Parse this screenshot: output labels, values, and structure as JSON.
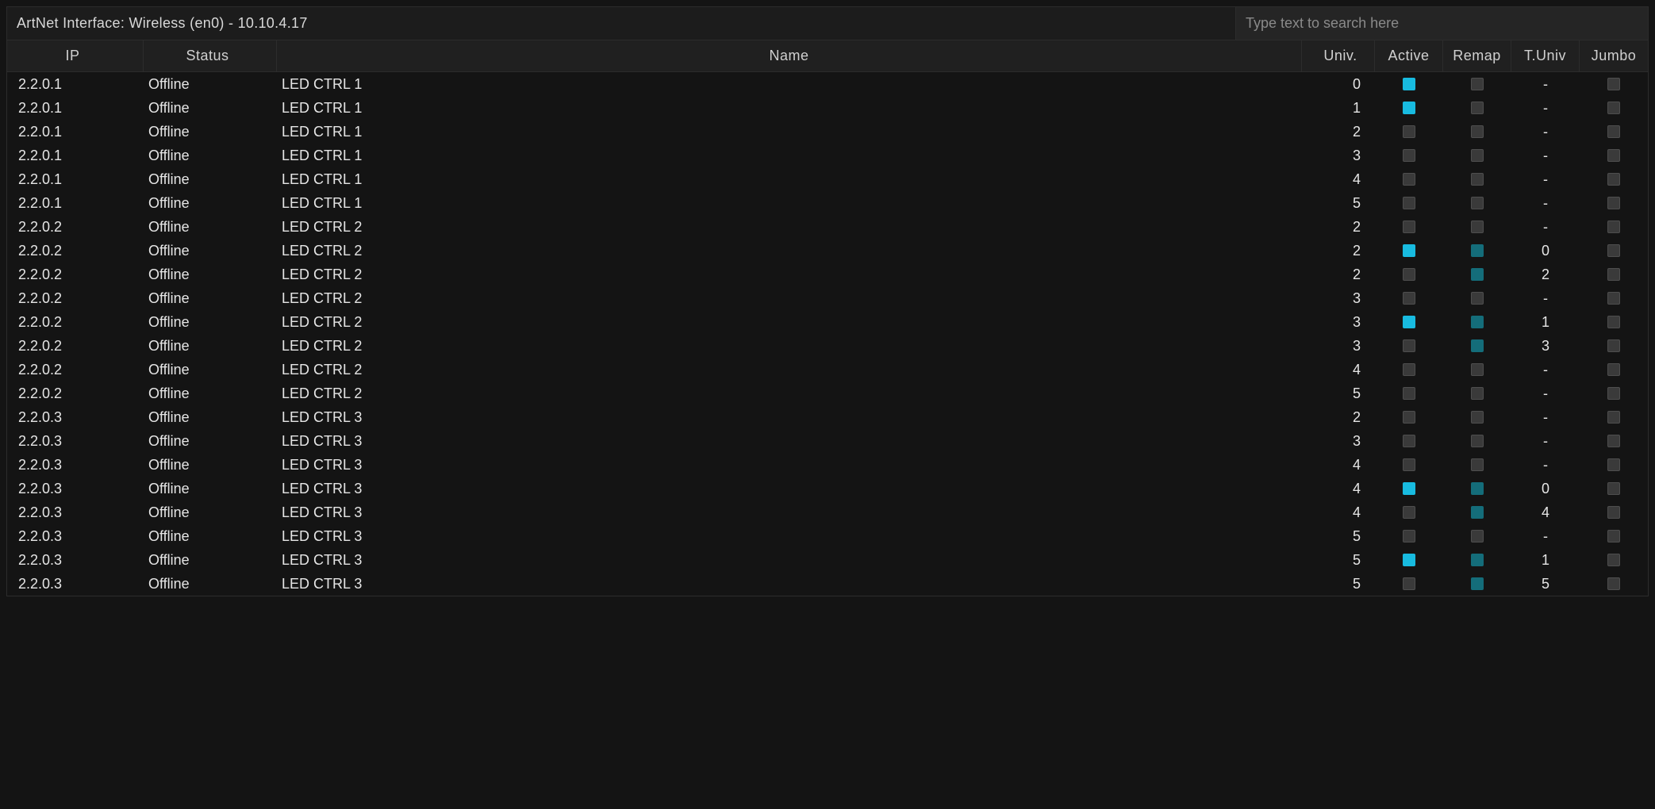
{
  "title": "ArtNet Interface: Wireless (en0) - 10.10.4.17",
  "search_placeholder": "Type text to search here",
  "columns": {
    "ip": "IP",
    "status": "Status",
    "name": "Name",
    "univ": "Univ.",
    "active": "Active",
    "remap": "Remap",
    "tuniv": "T.Univ",
    "jumbo": "Jumbo"
  },
  "rows": [
    {
      "ip": "2.2.0.1",
      "status": "Offline",
      "name": "LED CTRL 1",
      "univ": "0",
      "active": true,
      "remap": false,
      "tuniv": "-",
      "jumbo": false
    },
    {
      "ip": "2.2.0.1",
      "status": "Offline",
      "name": "LED CTRL 1",
      "univ": "1",
      "active": true,
      "remap": false,
      "tuniv": "-",
      "jumbo": false
    },
    {
      "ip": "2.2.0.1",
      "status": "Offline",
      "name": "LED CTRL 1",
      "univ": "2",
      "active": false,
      "remap": false,
      "tuniv": "-",
      "jumbo": false
    },
    {
      "ip": "2.2.0.1",
      "status": "Offline",
      "name": "LED CTRL 1",
      "univ": "3",
      "active": false,
      "remap": false,
      "tuniv": "-",
      "jumbo": false
    },
    {
      "ip": "2.2.0.1",
      "status": "Offline",
      "name": "LED CTRL 1",
      "univ": "4",
      "active": false,
      "remap": false,
      "tuniv": "-",
      "jumbo": false
    },
    {
      "ip": "2.2.0.1",
      "status": "Offline",
      "name": "LED CTRL 1",
      "univ": "5",
      "active": false,
      "remap": false,
      "tuniv": "-",
      "jumbo": false
    },
    {
      "ip": "2.2.0.2",
      "status": "Offline",
      "name": "LED CTRL 2",
      "univ": "2",
      "active": false,
      "remap": false,
      "tuniv": "-",
      "jumbo": false
    },
    {
      "ip": "2.2.0.2",
      "status": "Offline",
      "name": "LED CTRL 2",
      "univ": "2",
      "active": true,
      "remap": true,
      "tuniv": "0",
      "jumbo": false
    },
    {
      "ip": "2.2.0.2",
      "status": "Offline",
      "name": "LED CTRL 2",
      "univ": "2",
      "active": false,
      "remap": true,
      "tuniv": "2",
      "jumbo": false
    },
    {
      "ip": "2.2.0.2",
      "status": "Offline",
      "name": "LED CTRL 2",
      "univ": "3",
      "active": false,
      "remap": false,
      "tuniv": "-",
      "jumbo": false
    },
    {
      "ip": "2.2.0.2",
      "status": "Offline",
      "name": "LED CTRL 2",
      "univ": "3",
      "active": true,
      "remap": true,
      "tuniv": "1",
      "jumbo": false
    },
    {
      "ip": "2.2.0.2",
      "status": "Offline",
      "name": "LED CTRL 2",
      "univ": "3",
      "active": false,
      "remap": true,
      "tuniv": "3",
      "jumbo": false
    },
    {
      "ip": "2.2.0.2",
      "status": "Offline",
      "name": "LED CTRL 2",
      "univ": "4",
      "active": false,
      "remap": false,
      "tuniv": "-",
      "jumbo": false
    },
    {
      "ip": "2.2.0.2",
      "status": "Offline",
      "name": "LED CTRL 2",
      "univ": "5",
      "active": false,
      "remap": false,
      "tuniv": "-",
      "jumbo": false
    },
    {
      "ip": "2.2.0.3",
      "status": "Offline",
      "name": "LED CTRL 3",
      "univ": "2",
      "active": false,
      "remap": false,
      "tuniv": "-",
      "jumbo": false
    },
    {
      "ip": "2.2.0.3",
      "status": "Offline",
      "name": "LED CTRL 3",
      "univ": "3",
      "active": false,
      "remap": false,
      "tuniv": "-",
      "jumbo": false
    },
    {
      "ip": "2.2.0.3",
      "status": "Offline",
      "name": "LED CTRL 3",
      "univ": "4",
      "active": false,
      "remap": false,
      "tuniv": "-",
      "jumbo": false
    },
    {
      "ip": "2.2.0.3",
      "status": "Offline",
      "name": "LED CTRL 3",
      "univ": "4",
      "active": true,
      "remap": true,
      "tuniv": "0",
      "jumbo": false
    },
    {
      "ip": "2.2.0.3",
      "status": "Offline",
      "name": "LED CTRL 3",
      "univ": "4",
      "active": false,
      "remap": true,
      "tuniv": "4",
      "jumbo": false
    },
    {
      "ip": "2.2.0.3",
      "status": "Offline",
      "name": "LED CTRL 3",
      "univ": "5",
      "active": false,
      "remap": false,
      "tuniv": "-",
      "jumbo": false
    },
    {
      "ip": "2.2.0.3",
      "status": "Offline",
      "name": "LED CTRL 3",
      "univ": "5",
      "active": true,
      "remap": true,
      "tuniv": "1",
      "jumbo": false
    },
    {
      "ip": "2.2.0.3",
      "status": "Offline",
      "name": "LED CTRL 3",
      "univ": "5",
      "active": false,
      "remap": true,
      "tuniv": "5",
      "jumbo": false
    }
  ]
}
